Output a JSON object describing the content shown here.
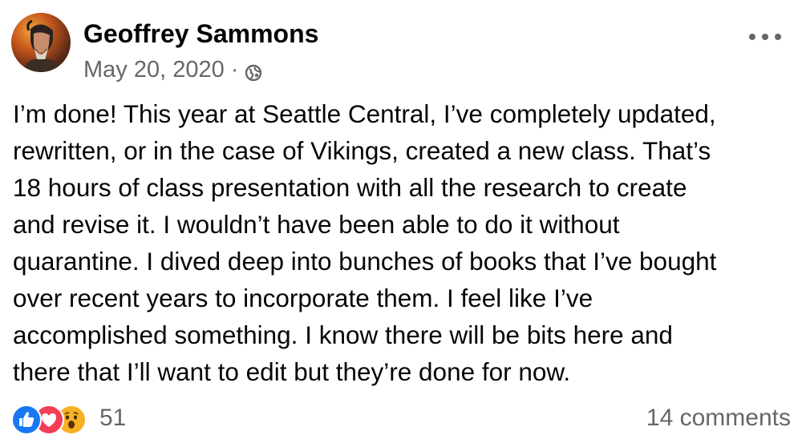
{
  "post": {
    "author": "Geoffrey Sammons",
    "date": "May 20, 2020",
    "date_separator": "·",
    "privacy_icon": "globe-icon",
    "more_icon": "more-options-icon",
    "text_lines": [
      "I’m done! This year at Seattle Central, I’ve completely updated,",
      "rewritten, or in the case of Vikings, created a new class. That’s",
      "18 hours of class presentation with all the research to create",
      "and revise it. I wouldn’t have been able to do it without",
      "quarantine. I dived deep into bunches of books that I’ve bought",
      "over recent years to incorporate them. I feel like I’ve",
      "accomplished something. I know there will be bits here and",
      "there that I’ll want to edit but they’re done for now."
    ]
  },
  "footer": {
    "reaction_icons": [
      "like-icon",
      "love-icon",
      "wow-icon"
    ],
    "reaction_count": "51",
    "comments": "14 comments"
  },
  "colors": {
    "text": "#050505",
    "secondary": "#65676b",
    "like": "#1877f2",
    "love": "#f33e58",
    "wow": "#f7b125"
  }
}
